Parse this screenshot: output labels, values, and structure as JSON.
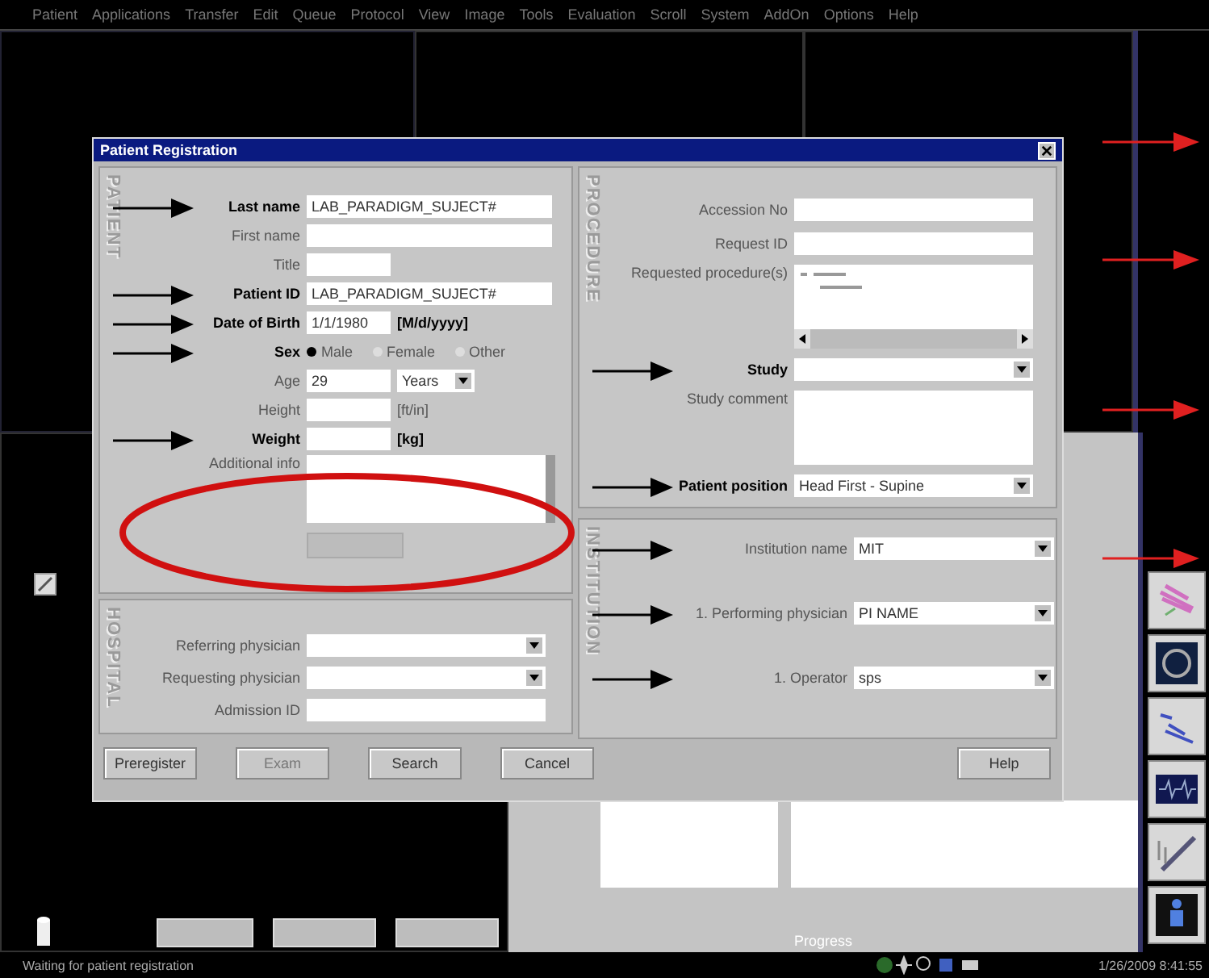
{
  "menu": [
    "Patient",
    "Applications",
    "Transfer",
    "Edit",
    "Queue",
    "Protocol",
    "View",
    "Image",
    "Tools",
    "Evaluation",
    "Scroll",
    "System",
    "AddOn",
    "Options",
    "Help"
  ],
  "dialog": {
    "title": "Patient Registration",
    "patient": {
      "heading": "PATIENT",
      "rows": [
        {
          "kind": "text",
          "label": "Last name",
          "bold": true,
          "arrow": true,
          "value": "LAB_PARADIGM_SUJECT#"
        },
        {
          "kind": "text",
          "label": "First name",
          "bold": false,
          "arrow": false
        },
        {
          "kind": "short",
          "label": "Title",
          "bold": false,
          "arrow": false
        },
        {
          "kind": "text",
          "label": "Patient ID",
          "bold": true,
          "arrow": true,
          "value": "LAB_PARADIGM_SUJECT#"
        },
        {
          "kind": "short",
          "label": "Date of Birth",
          "bold": true,
          "arrow": true,
          "value": "1/1/1980",
          "unit": "[M/d/yyyy]"
        },
        {
          "kind": "radio",
          "label": "Sex",
          "bold": true,
          "arrow": true,
          "options": [
            {
              "label": "Male",
              "selected": true
            },
            {
              "label": "Female",
              "selected": false
            },
            {
              "label": "Other",
              "selected": false
            }
          ]
        },
        {
          "kind": "short",
          "label": "Age",
          "bold": false,
          "arrow": false,
          "value": "29",
          "select": "Years"
        },
        {
          "kind": "short",
          "label": "Height",
          "bold": false,
          "arrow": false,
          "unit": "[ft/in]"
        },
        {
          "kind": "short",
          "label": "Weight",
          "bold": true,
          "arrow": true,
          "unit": "[kg]"
        },
        {
          "kind": "textarea",
          "label": "Additional info",
          "bold": false,
          "arrow": false
        },
        {
          "kind": "button",
          "disabled": true
        }
      ]
    },
    "hospital": {
      "heading": "HOSPITAL",
      "rows": [
        {
          "kind": "select",
          "label": "Referring physician",
          "bold": false,
          "arrow": false
        },
        {
          "kind": "select",
          "label": "Requesting physician",
          "bold": false,
          "arrow": false
        },
        {
          "kind": "text",
          "label": "Admission ID",
          "bold": false,
          "arrow": false
        }
      ]
    },
    "procedure": {
      "heading": "PROCEDURE",
      "rows": [
        {
          "kind": "text",
          "label": "Accession No",
          "bold": false,
          "arrow": false
        },
        {
          "kind": "text",
          "label": "Request ID",
          "bold": false,
          "arrow": false
        },
        {
          "kind": "list",
          "label": "Requested procedure(s)",
          "bold": false,
          "arrow": false
        },
        {
          "kind": "select",
          "label": "Study",
          "bold": true,
          "arrow": true
        },
        {
          "kind": "textarea",
          "label": "Study comment",
          "bold": false,
          "arrow": false
        },
        {
          "kind": "select",
          "label": "Patient position",
          "bold": true,
          "arrow": true,
          "value": "Head First - Supine"
        }
      ]
    },
    "institution": {
      "heading": "INSTITUTION",
      "rows": [
        {
          "kind": "select",
          "label": "Institution name",
          "bold": false,
          "arrow": true,
          "value": "MIT"
        },
        {
          "kind": "select",
          "label": "1. Performing physician",
          "bold": false,
          "arrow": true,
          "value": "PI NAME"
        },
        {
          "kind": "select",
          "label": "1. Operator",
          "bold": false,
          "arrow": true,
          "value": "sps"
        }
      ]
    },
    "buttons": [
      {
        "label": "Preregister",
        "disabled": false
      },
      {
        "label": "Exam",
        "disabled": true
      },
      {
        "label": "Search",
        "disabled": false
      },
      {
        "label": "Cancel",
        "disabled": false
      }
    ],
    "help_button": "Help"
  },
  "progress_label": "Progress",
  "status": {
    "message": "Waiting for patient registration",
    "datetime": "1/26/2009 8:41:55"
  }
}
